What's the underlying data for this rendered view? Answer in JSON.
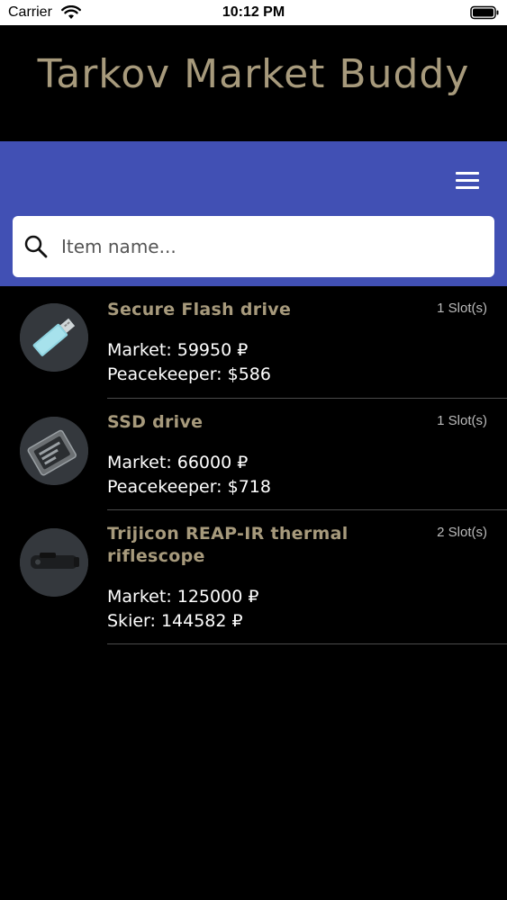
{
  "status_bar": {
    "carrier": "Carrier",
    "time": "10:12 PM",
    "icons": [
      "wifi-icon",
      "battery-icon"
    ]
  },
  "header": {
    "title": "Tarkov Market Buddy"
  },
  "toolbar": {
    "menu_icon": "hamburger-menu-icon",
    "background": "#4150b4"
  },
  "search": {
    "placeholder": "Item name...",
    "value": "",
    "icon": "search-icon"
  },
  "items": [
    {
      "name": "Secure Flash drive",
      "slots": "1 Slot(s)",
      "market": "Market: 59950 ₽",
      "trader": "Peacekeeper: $586",
      "icon": "flash-drive-icon"
    },
    {
      "name": "SSD drive",
      "slots": "1 Slot(s)",
      "market": "Market: 66000 ₽",
      "trader": "Peacekeeper: $718",
      "icon": "ssd-drive-icon"
    },
    {
      "name": "Trijicon REAP-IR thermal riflescope",
      "slots": "2 Slot(s)",
      "market": "Market: 125000 ₽",
      "trader": "Skier: 144582 ₽",
      "icon": "riflescope-icon"
    }
  ],
  "colors": {
    "title": "#a79a7c",
    "accent": "#4150b4",
    "background": "#000000"
  }
}
